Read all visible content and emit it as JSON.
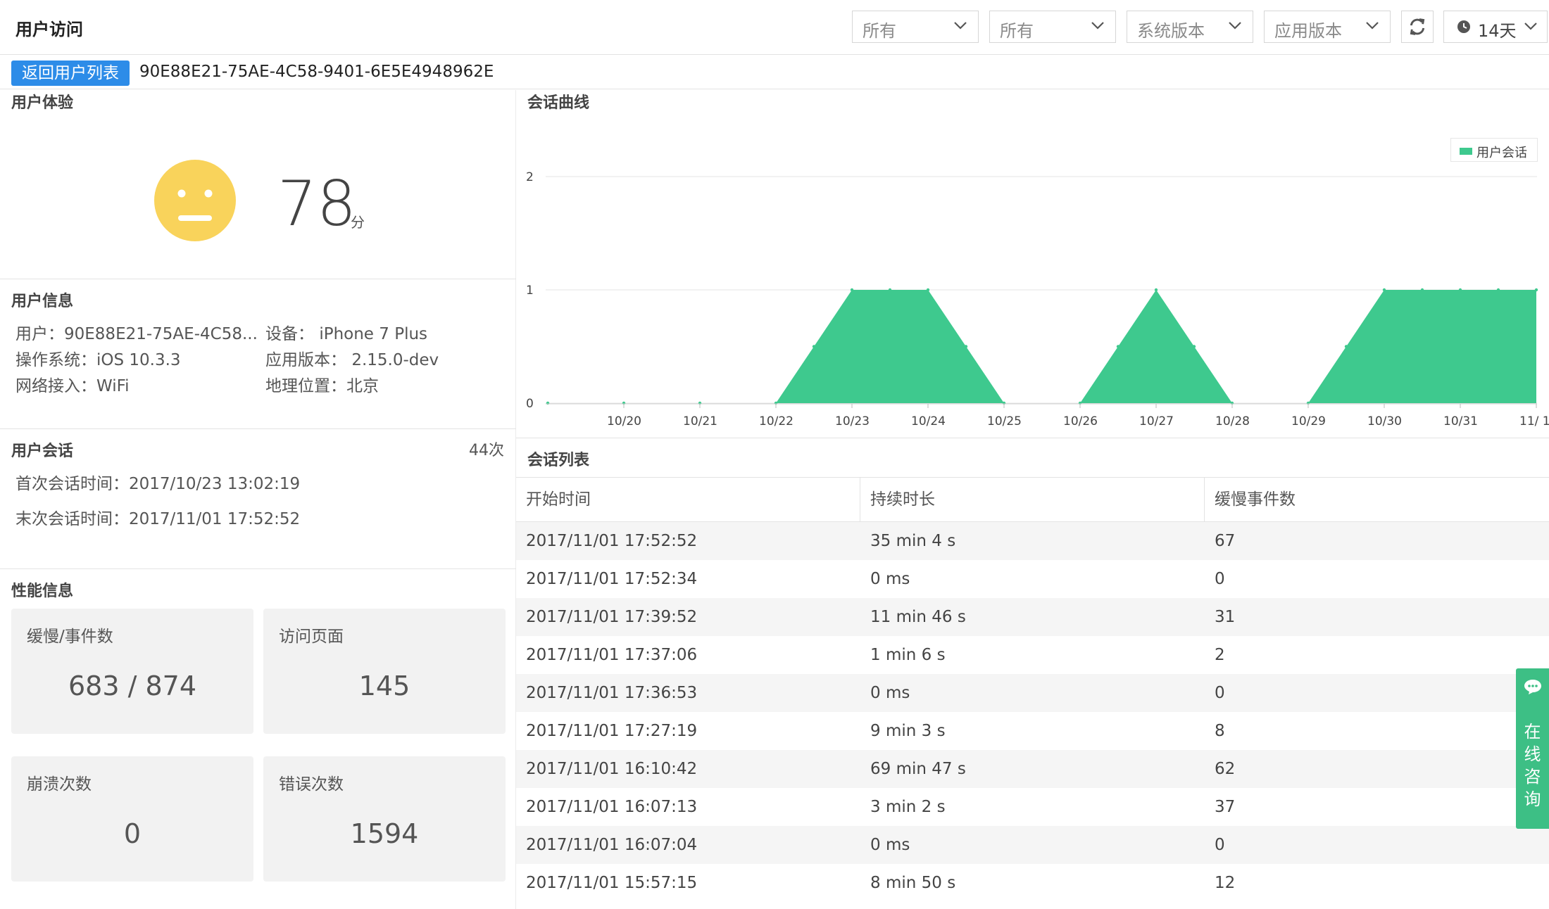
{
  "header": {
    "title": "用户访问",
    "filters": [
      {
        "value": "所有"
      },
      {
        "value": "所有"
      },
      {
        "value": "系统版本"
      },
      {
        "value": "应用版本"
      }
    ],
    "time_range": "14天",
    "icons": {
      "refresh": "refresh-icon",
      "clock": "clock-icon",
      "dropdown": "chevron-down-icon"
    }
  },
  "breadcrumb": {
    "back_label": "返回用户列表",
    "user_id": "90E88E21-75AE-4C58-9401-6E5E4948962E"
  },
  "experience": {
    "title": "用户体验",
    "score": "78",
    "unit": "分",
    "face_icon": "neutral-face-icon",
    "face_color": "#f9d35b"
  },
  "user_info": {
    "title": "用户信息",
    "user_label": "用户：",
    "user_value": "90E88E21-75AE-4C58...",
    "device_label": "设备：",
    "device_value": "iPhone 7 Plus",
    "os_label": "操作系统：",
    "os_value": "iOS 10.3.3",
    "app_version_label": "应用版本：",
    "app_version_value": "2.15.0-dev",
    "network_label": "网络接入：",
    "network_value": "WiFi",
    "location_label": "地理位置：",
    "location_value": "北京"
  },
  "sessions_info": {
    "title": "用户会话",
    "count": "44次",
    "first_label": "首次会话时间：",
    "first_value": "2017/10/23 13:02:19",
    "last_label": "末次会话时间：",
    "last_value": "2017/11/01 17:52:52"
  },
  "performance": {
    "title": "性能信息",
    "cards": [
      {
        "label": "缓慢/事件数",
        "value": "683 / 874"
      },
      {
        "label": "访问页面",
        "value": "145"
      },
      {
        "label": "崩溃次数",
        "value": "0"
      },
      {
        "label": "错误次数",
        "value": "1594"
      }
    ]
  },
  "chart_title": "会话曲线",
  "chart_data": {
    "type": "area",
    "title": "会话曲线",
    "categories": [
      "10/20",
      "10/21",
      "10/22",
      "10/23",
      "10/24",
      "10/25",
      "10/26",
      "10/27",
      "10/28",
      "10/29",
      "10/30",
      "10/31",
      "11/ 1"
    ],
    "x": [
      "10/19 12:00",
      "10/20 12:00",
      "10/21 12:00",
      "10/22 12:00",
      "10/23 00:00",
      "10/23 12:00",
      "10/24 00:00",
      "10/24 12:00",
      "10/25 00:00",
      "10/25 12:00",
      "10/26 12:00",
      "10/27 00:00",
      "10/27 12:00",
      "10/28 00:00",
      "10/28 12:00",
      "10/29 12:00",
      "10/30 00:00",
      "10/30 12:00",
      "10/31 00:00",
      "10/31 12:00",
      "11/1 00:00",
      "11/1 12:00"
    ],
    "series": [
      {
        "name": "用户会话",
        "color": "#3ec98e",
        "values": [
          0,
          0,
          0,
          0,
          0.5,
          1,
          1,
          1,
          0.5,
          0,
          0,
          0.5,
          1,
          0.5,
          0,
          0,
          0.5,
          1,
          1,
          1,
          1,
          1
        ]
      }
    ],
    "yticks": [
      0,
      1,
      2
    ],
    "ylim": [
      0,
      2
    ],
    "legend": "top-right",
    "grid": true
  },
  "table": {
    "title": "会话列表",
    "columns": [
      "开始时间",
      "持续时长",
      "缓慢事件数"
    ],
    "rows": [
      [
        "2017/11/01 17:52:52",
        "35 min 4 s",
        "67"
      ],
      [
        "2017/11/01 17:52:34",
        "0 ms",
        "0"
      ],
      [
        "2017/11/01 17:39:52",
        "11 min 46 s",
        "31"
      ],
      [
        "2017/11/01 17:37:06",
        "1 min 6 s",
        "2"
      ],
      [
        "2017/11/01 17:36:53",
        "0 ms",
        "0"
      ],
      [
        "2017/11/01 17:27:19",
        "9 min 3 s",
        "8"
      ],
      [
        "2017/11/01 16:10:42",
        "69 min 47 s",
        "62"
      ],
      [
        "2017/11/01 16:07:13",
        "3 min 2 s",
        "37"
      ],
      [
        "2017/11/01 16:07:04",
        "0 ms",
        "0"
      ],
      [
        "2017/11/01 15:57:15",
        "8 min 50 s",
        "12"
      ]
    ]
  },
  "consult": {
    "label": "在线咨询",
    "icon": "chat-bubble-icon",
    "color": "#3dbf85"
  }
}
